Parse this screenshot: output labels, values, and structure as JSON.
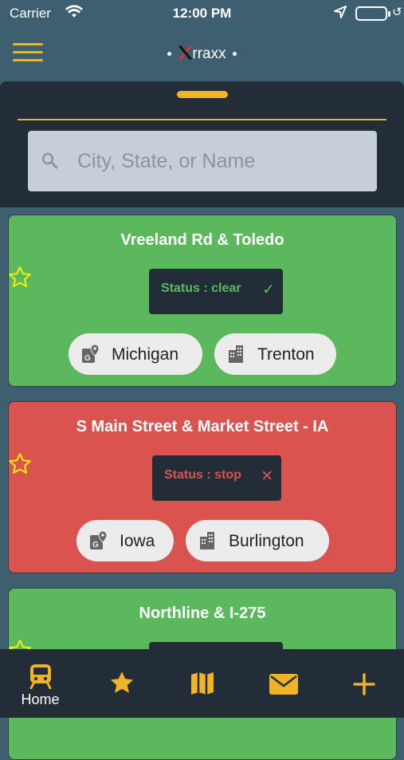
{
  "status_bar": {
    "carrier": "Carrier",
    "time": "12:00 PM"
  },
  "header": {
    "app_name": "rraxx"
  },
  "search": {
    "placeholder": "City, State, or Name",
    "value": ""
  },
  "crossings": [
    {
      "title": "Vreeland Rd & Toledo",
      "status": "Status : clear",
      "state": "Michigan",
      "city": "Trenton",
      "color": "#5cb85c"
    },
    {
      "title": "S Main Street & Market Street - IA",
      "status": "Status : stop",
      "state": "Iowa",
      "city": "Burlington",
      "color": "#d9534f"
    },
    {
      "title": "Northline & I-275",
      "color": "#5cb85c"
    }
  ],
  "tab_bar": {
    "items": [
      {
        "label": "Home",
        "icon": "train-icon"
      },
      {
        "label": "",
        "icon": "star-icon"
      },
      {
        "label": "",
        "icon": "map-icon"
      },
      {
        "label": "",
        "icon": "mail-icon"
      },
      {
        "label": "",
        "icon": "plus-icon"
      }
    ]
  },
  "colors": {
    "accent": "#f0b323",
    "clear": "#5cb85c",
    "stop": "#d9534f",
    "dark": "#222d38",
    "background": "#3d5f70"
  }
}
